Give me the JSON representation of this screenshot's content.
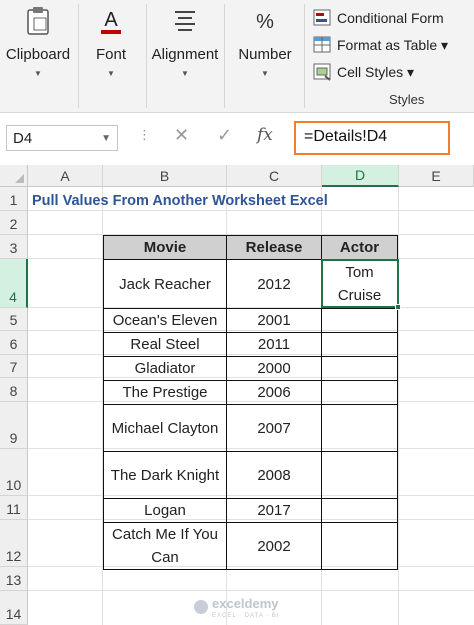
{
  "ribbon": {
    "clipboard": {
      "label": "Clipboard",
      "icon": "clipboard-icon"
    },
    "font": {
      "label": "Font",
      "icon": "font-color-icon",
      "glyph": "A"
    },
    "alignment": {
      "label": "Alignment",
      "icon": "align-icon"
    },
    "number": {
      "label": "Number",
      "icon": "percent-icon",
      "glyph": "%"
    },
    "styles": {
      "items": [
        {
          "label": "Conditional Form",
          "icon": "conditional-formatting-icon"
        },
        {
          "label": "Format as Table ▾",
          "icon": "format-table-icon"
        },
        {
          "label": "Cell Styles ▾",
          "icon": "cell-styles-icon"
        }
      ],
      "group_label": "Styles"
    }
  },
  "formula_bar": {
    "name_box": "D4",
    "formula": "=Details!D4",
    "cancel_glyph": "✕",
    "enter_glyph": "✓",
    "fx_glyph": "fx",
    "dots": "⋮"
  },
  "columns": [
    "A",
    "B",
    "C",
    "D",
    "E"
  ],
  "rows": [
    "1",
    "2",
    "3",
    "4",
    "5",
    "6",
    "7",
    "8",
    "9",
    "10",
    "11",
    "12",
    "13",
    "14"
  ],
  "sheet": {
    "title": "Pull Values From Another Worksheet Excel",
    "headers": {
      "movie": "Movie",
      "release": "Release",
      "actor": "Actor"
    },
    "records": [
      {
        "movie": "Jack Reacher",
        "release": "2012",
        "actor_line1": "Tom",
        "actor_line2": "Cruise"
      },
      {
        "movie": "Ocean's Eleven",
        "release": "2001",
        "actor": ""
      },
      {
        "movie": "Real Steel",
        "release": "2011",
        "actor": ""
      },
      {
        "movie": "Gladiator",
        "release": "2000",
        "actor": ""
      },
      {
        "movie": "The Prestige",
        "release": "2006",
        "actor": ""
      },
      {
        "movie": "Michael Clayton",
        "release": "2007",
        "actor": ""
      },
      {
        "movie": "The Dark Knight",
        "release": "2008",
        "actor": ""
      },
      {
        "movie": "Logan",
        "release": "2017",
        "actor": ""
      },
      {
        "movie_line1": "Catch Me If You",
        "movie_line2": "Can",
        "release": "2002",
        "actor": ""
      }
    ]
  },
  "watermark": {
    "name": "exceldemy",
    "tagline": "EXCEL · DATA · BI"
  },
  "colors": {
    "accent": "#217346",
    "formula_highlight": "#ef7f2b",
    "title": "#2f5597",
    "header_fill": "#d0d0d0"
  }
}
